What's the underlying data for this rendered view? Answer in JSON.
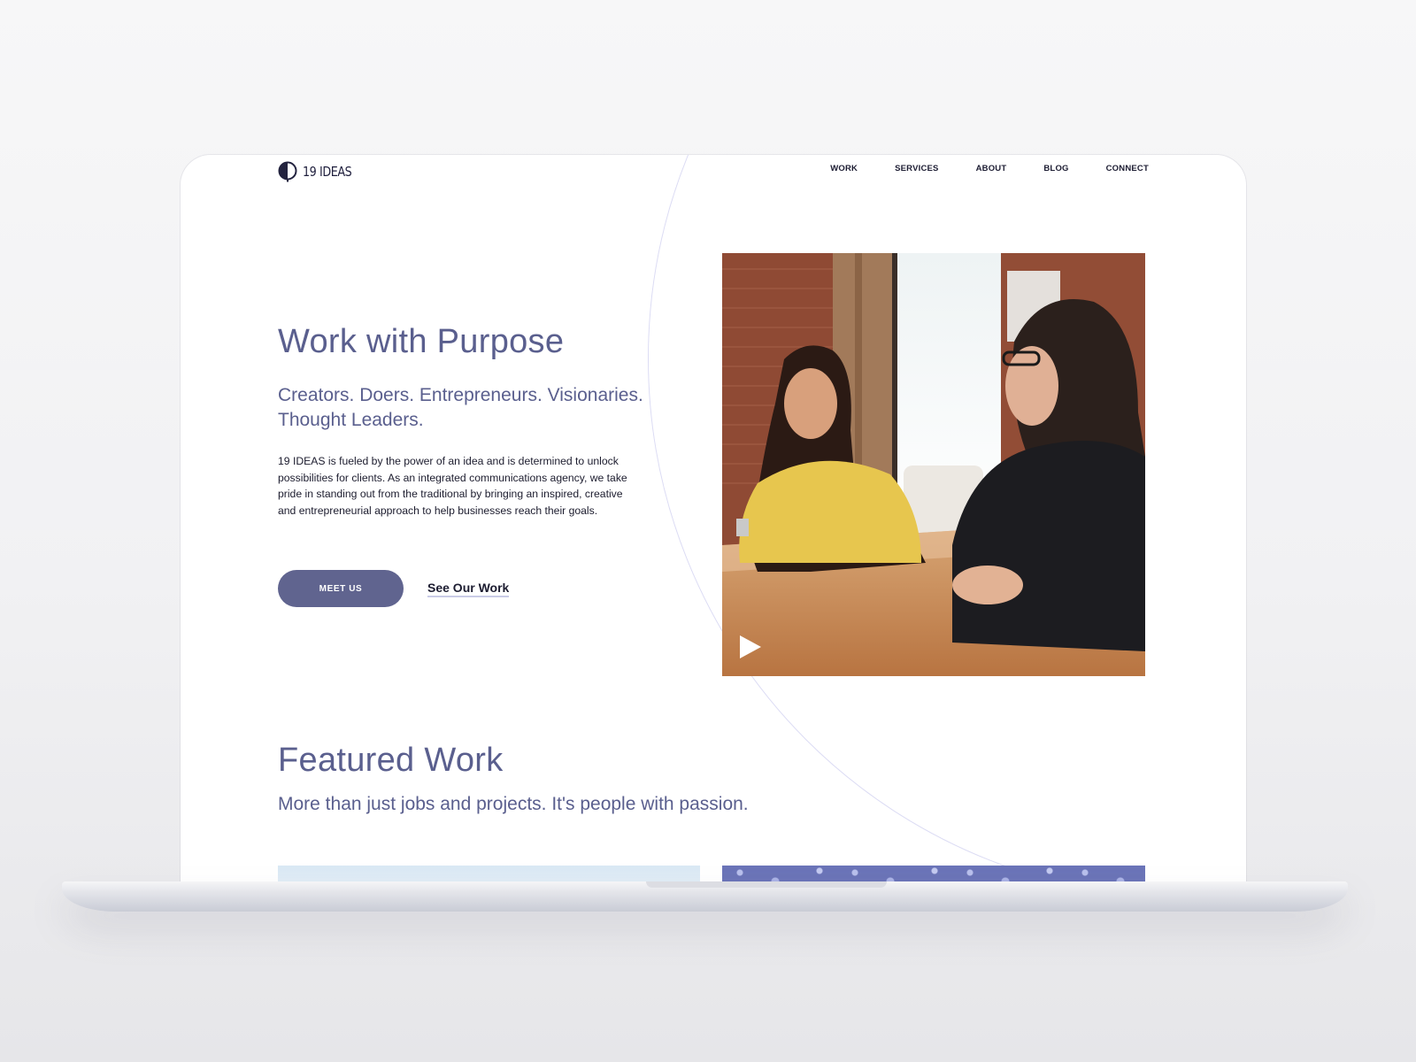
{
  "brand": {
    "name": "19 IDEAS",
    "logo_icon": "half-circle-logo-icon"
  },
  "nav": {
    "items": [
      {
        "label": "WORK"
      },
      {
        "label": "SERVICES"
      },
      {
        "label": "ABOUT"
      },
      {
        "label": "BLOG"
      },
      {
        "label": "CONNECT"
      }
    ]
  },
  "hero": {
    "title": "Work with Purpose",
    "subtitle": "Creators. Doers. Entrepreneurs. Visionaries. Thought Leaders.",
    "body": "19 IDEAS is fueled by the power of an idea and is determined to unlock possibilities for clients. As an integrated communications agency, we take pride in standing out from the traditional by bringing an inspired, creative and entrepreneurial approach to help businesses reach their goals.",
    "primary_button": "MEET US",
    "secondary_link": "See Our Work",
    "video_icon": "play-icon"
  },
  "featured": {
    "title": "Featured Work",
    "subtitle": "More than just jobs and projects. It's people with passion."
  },
  "colors": {
    "accent": "#60648f",
    "heading": "#5a5f8e",
    "text": "#1c1c2e",
    "decorative_circle": "#dcdcf4"
  }
}
